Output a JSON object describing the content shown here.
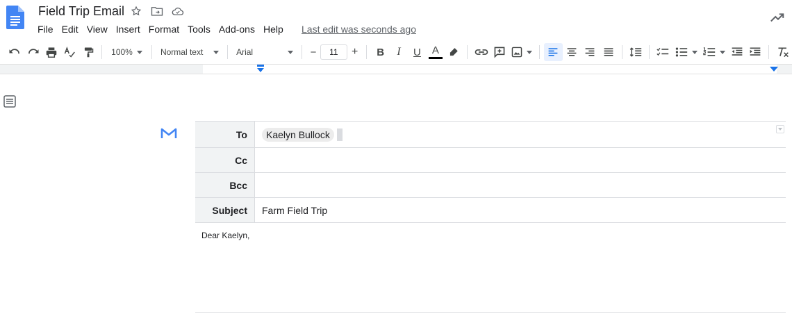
{
  "document": {
    "title": "Field Trip Email",
    "last_edit": "Last edit was seconds ago"
  },
  "menu": [
    "File",
    "Edit",
    "View",
    "Insert",
    "Format",
    "Tools",
    "Add-ons",
    "Help"
  ],
  "toolbar": {
    "zoom": "100%",
    "style": "Normal text",
    "font": "Arial",
    "font_size": "11",
    "bold_label": "B",
    "italic_label": "I",
    "underline_label": "U",
    "text_color_label": "A",
    "decrease_label": "−",
    "increase_label": "+"
  },
  "email": {
    "to_label": "To",
    "to_recipient": "Kaelyn Bullock",
    "cc_label": "Cc",
    "bcc_label": "Bcc",
    "subject_label": "Subject",
    "subject": "Farm Field Trip",
    "body": "Dear Kaelyn,"
  },
  "colors": {
    "accent": "#1a73e8",
    "docs_blue": "#4285f4"
  }
}
